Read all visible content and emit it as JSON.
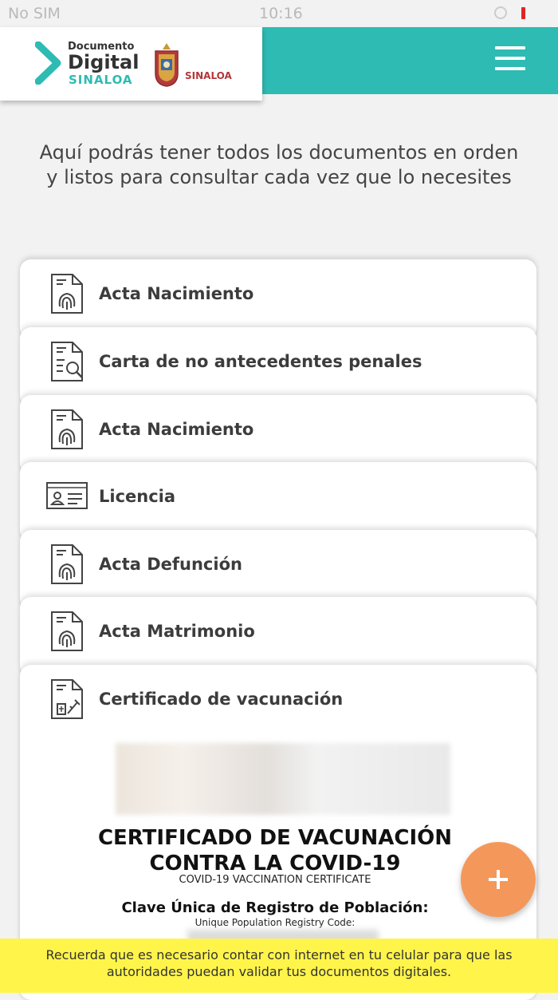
{
  "status_bar": {
    "carrier": "No SIM",
    "time": "10:16"
  },
  "header": {
    "logo": {
      "line1": "Documento",
      "line2": "Digital",
      "line3": "SINALOA",
      "seal_label": "SINALOA"
    },
    "menu_icon": "hamburger-menu-icon",
    "colors": {
      "teal": "#2dbbb3",
      "accent_orange": "#f4975a",
      "banner_yellow": "#fff54a"
    }
  },
  "intro_text": "Aquí podrás tener todos los documentos en orden y listos para consultar cada vez que lo necesites",
  "documents": [
    {
      "label": "Acta Nacimiento",
      "icon": "fingerprint-document-icon"
    },
    {
      "label": "Carta de no antecedentes penales",
      "icon": "search-document-icon"
    },
    {
      "label": "Acta Nacimiento",
      "icon": "fingerprint-document-icon"
    },
    {
      "label": "Licencia",
      "icon": "id-card-icon"
    },
    {
      "label": "Acta Defunción",
      "icon": "fingerprint-document-icon"
    },
    {
      "label": "Acta Matrimonio",
      "icon": "fingerprint-document-icon"
    },
    {
      "label": "Certificado de vacunación",
      "icon": "vaccine-document-icon"
    }
  ],
  "certificate_preview": {
    "title_line1": "CERTIFICADO DE VACUNACIÓN",
    "title_line2": "CONTRA LA COVID-19",
    "subtitle": "COVID-19 VACCINATION CERTIFICATE",
    "clave_label": "Clave Única de Registro de Población:",
    "clave_sub": "Unique Population Registry Code:"
  },
  "fab": {
    "icon": "plus-icon"
  },
  "footer_banner": "Recuerda que es necesario contar con internet en tu celular para que las autoridades puedan validar tus documentos digitales."
}
